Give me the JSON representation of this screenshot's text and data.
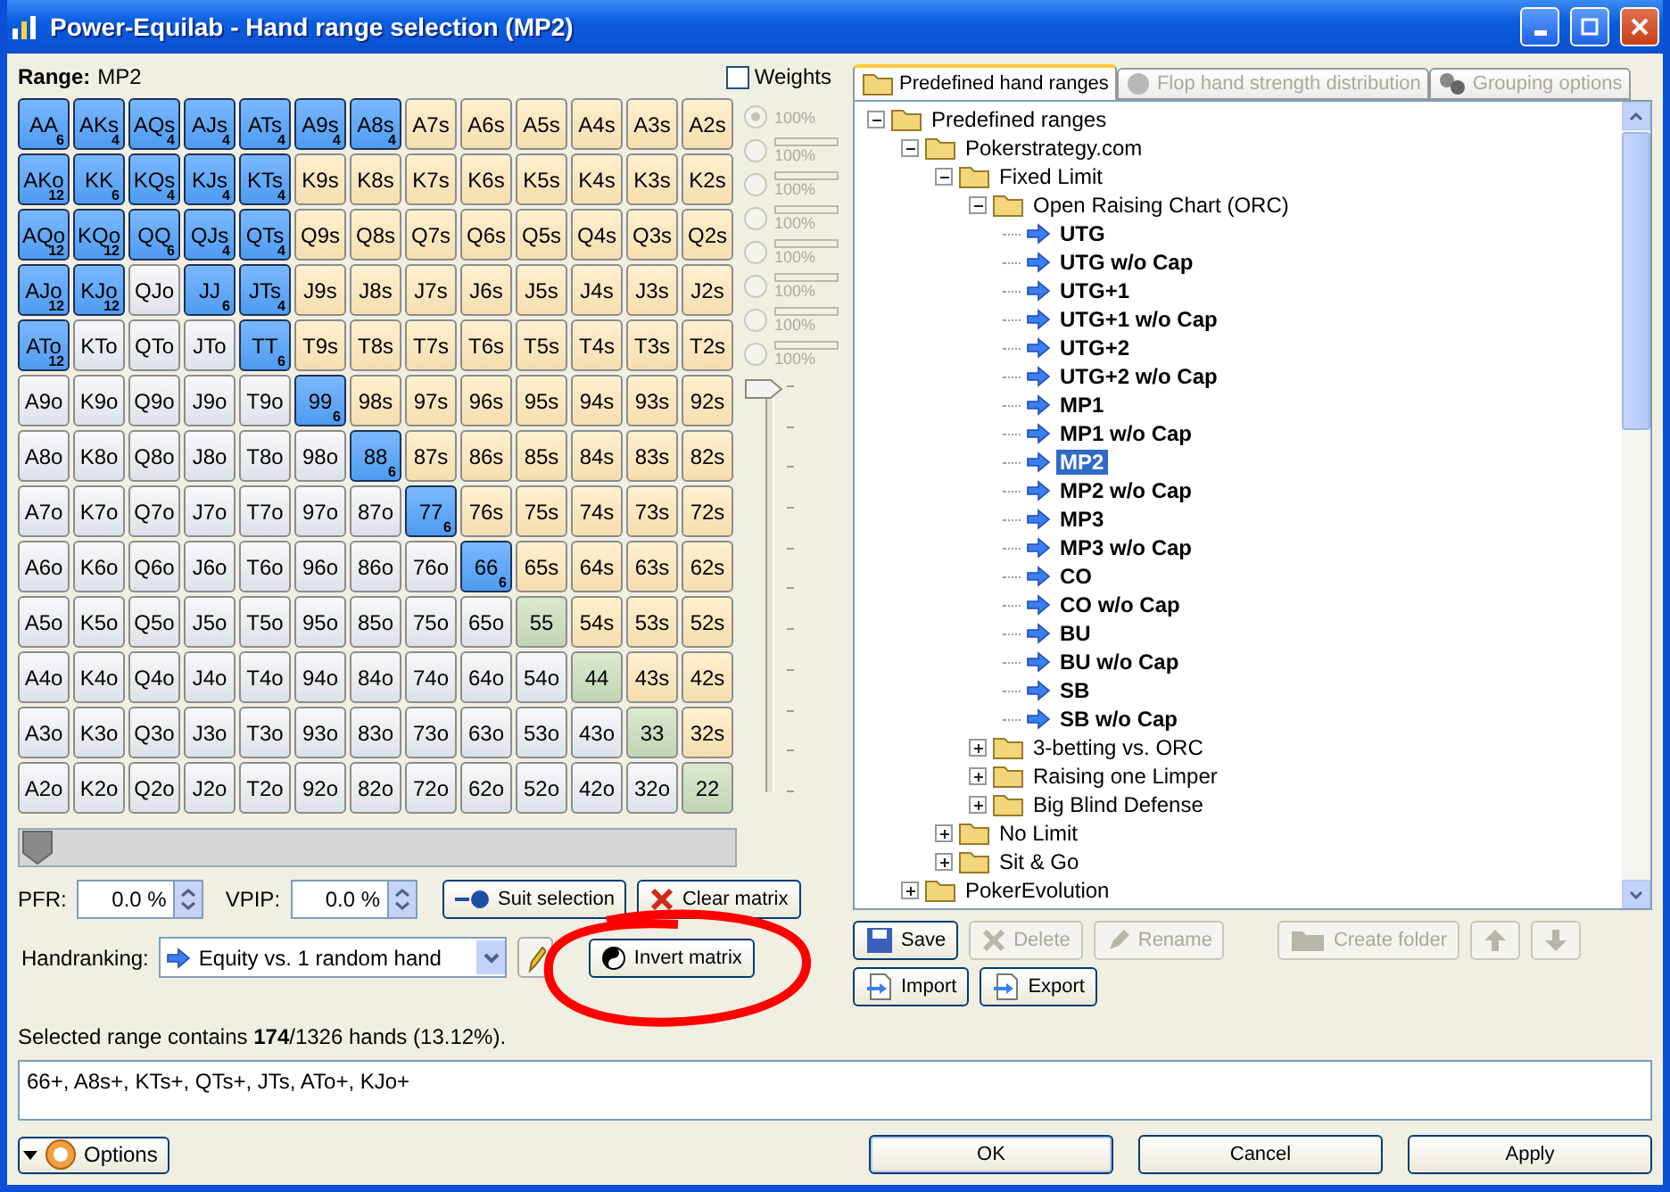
{
  "window": {
    "title": "Power-Equilab - Hand range selection (MP2)"
  },
  "range": {
    "label": "Range:",
    "value": "MP2"
  },
  "matrix": {
    "rows": [
      [
        {
          "label": "AA",
          "kind": "pair",
          "selected": true,
          "count": "6"
        },
        {
          "label": "AKs",
          "kind": "suited",
          "selected": true,
          "count": "4"
        },
        {
          "label": "AQs",
          "kind": "suited",
          "selected": true,
          "count": "4"
        },
        {
          "label": "AJs",
          "kind": "suited",
          "selected": true,
          "count": "4"
        },
        {
          "label": "ATs",
          "kind": "suited",
          "selected": true,
          "count": "4"
        },
        {
          "label": "A9s",
          "kind": "suited",
          "selected": true,
          "count": "4"
        },
        {
          "label": "A8s",
          "kind": "suited",
          "selected": true,
          "count": "4"
        },
        {
          "label": "A7s",
          "kind": "suited",
          "selected": false
        },
        {
          "label": "A6s",
          "kind": "suited",
          "selected": false
        },
        {
          "label": "A5s",
          "kind": "suited",
          "selected": false
        },
        {
          "label": "A4s",
          "kind": "suited",
          "selected": false
        },
        {
          "label": "A3s",
          "kind": "suited",
          "selected": false
        },
        {
          "label": "A2s",
          "kind": "suited",
          "selected": false
        }
      ],
      [
        {
          "label": "AKo",
          "kind": "offsuit",
          "selected": true,
          "count": "12"
        },
        {
          "label": "KK",
          "kind": "pair",
          "selected": true,
          "count": "6"
        },
        {
          "label": "KQs",
          "kind": "suited",
          "selected": true,
          "count": "4"
        },
        {
          "label": "KJs",
          "kind": "suited",
          "selected": true,
          "count": "4"
        },
        {
          "label": "KTs",
          "kind": "suited",
          "selected": true,
          "count": "4"
        },
        {
          "label": "K9s",
          "kind": "suited",
          "selected": false
        },
        {
          "label": "K8s",
          "kind": "suited",
          "selected": false
        },
        {
          "label": "K7s",
          "kind": "suited",
          "selected": false
        },
        {
          "label": "K6s",
          "kind": "suited",
          "selected": false
        },
        {
          "label": "K5s",
          "kind": "suited",
          "selected": false
        },
        {
          "label": "K4s",
          "kind": "suited",
          "selected": false
        },
        {
          "label": "K3s",
          "kind": "suited",
          "selected": false
        },
        {
          "label": "K2s",
          "kind": "suited",
          "selected": false
        }
      ],
      [
        {
          "label": "AQo",
          "kind": "offsuit",
          "selected": true,
          "count": "12"
        },
        {
          "label": "KQo",
          "kind": "offsuit",
          "selected": true,
          "count": "12"
        },
        {
          "label": "QQ",
          "kind": "pair",
          "selected": true,
          "count": "6"
        },
        {
          "label": "QJs",
          "kind": "suited",
          "selected": true,
          "count": "4"
        },
        {
          "label": "QTs",
          "kind": "suited",
          "selected": true,
          "count": "4"
        },
        {
          "label": "Q9s",
          "kind": "suited",
          "selected": false
        },
        {
          "label": "Q8s",
          "kind": "suited",
          "selected": false
        },
        {
          "label": "Q7s",
          "kind": "suited",
          "selected": false
        },
        {
          "label": "Q6s",
          "kind": "suited",
          "selected": false
        },
        {
          "label": "Q5s",
          "kind": "suited",
          "selected": false
        },
        {
          "label": "Q4s",
          "kind": "suited",
          "selected": false
        },
        {
          "label": "Q3s",
          "kind": "suited",
          "selected": false
        },
        {
          "label": "Q2s",
          "kind": "suited",
          "selected": false
        }
      ],
      [
        {
          "label": "AJo",
          "kind": "offsuit",
          "selected": true,
          "count": "12"
        },
        {
          "label": "KJo",
          "kind": "offsuit",
          "selected": true,
          "count": "12"
        },
        {
          "label": "QJo",
          "kind": "offsuit",
          "selected": false
        },
        {
          "label": "JJ",
          "kind": "pair",
          "selected": true,
          "count": "6"
        },
        {
          "label": "JTs",
          "kind": "suited",
          "selected": true,
          "count": "4"
        },
        {
          "label": "J9s",
          "kind": "suited",
          "selected": false
        },
        {
          "label": "J8s",
          "kind": "suited",
          "selected": false
        },
        {
          "label": "J7s",
          "kind": "suited",
          "selected": false
        },
        {
          "label": "J6s",
          "kind": "suited",
          "selected": false
        },
        {
          "label": "J5s",
          "kind": "suited",
          "selected": false
        },
        {
          "label": "J4s",
          "kind": "suited",
          "selected": false
        },
        {
          "label": "J3s",
          "kind": "suited",
          "selected": false
        },
        {
          "label": "J2s",
          "kind": "suited",
          "selected": false
        }
      ],
      [
        {
          "label": "ATo",
          "kind": "offsuit",
          "selected": true,
          "count": "12"
        },
        {
          "label": "KTo",
          "kind": "offsuit",
          "selected": false
        },
        {
          "label": "QTo",
          "kind": "offsuit",
          "selected": false
        },
        {
          "label": "JTo",
          "kind": "offsuit",
          "selected": false
        },
        {
          "label": "TT",
          "kind": "pair",
          "selected": true,
          "count": "6"
        },
        {
          "label": "T9s",
          "kind": "suited",
          "selected": false
        },
        {
          "label": "T8s",
          "kind": "suited",
          "selected": false
        },
        {
          "label": "T7s",
          "kind": "suited",
          "selected": false
        },
        {
          "label": "T6s",
          "kind": "suited",
          "selected": false
        },
        {
          "label": "T5s",
          "kind": "suited",
          "selected": false
        },
        {
          "label": "T4s",
          "kind": "suited",
          "selected": false
        },
        {
          "label": "T3s",
          "kind": "suited",
          "selected": false
        },
        {
          "label": "T2s",
          "kind": "suited",
          "selected": false
        }
      ],
      [
        {
          "label": "A9o",
          "kind": "offsuit",
          "selected": false
        },
        {
          "label": "K9o",
          "kind": "offsuit",
          "selected": false
        },
        {
          "label": "Q9o",
          "kind": "offsuit",
          "selected": false
        },
        {
          "label": "J9o",
          "kind": "offsuit",
          "selected": false
        },
        {
          "label": "T9o",
          "kind": "offsuit",
          "selected": false
        },
        {
          "label": "99",
          "kind": "pair",
          "selected": true,
          "count": "6"
        },
        {
          "label": "98s",
          "kind": "suited",
          "selected": false
        },
        {
          "label": "97s",
          "kind": "suited",
          "selected": false
        },
        {
          "label": "96s",
          "kind": "suited",
          "selected": false
        },
        {
          "label": "95s",
          "kind": "suited",
          "selected": false
        },
        {
          "label": "94s",
          "kind": "suited",
          "selected": false
        },
        {
          "label": "93s",
          "kind": "suited",
          "selected": false
        },
        {
          "label": "92s",
          "kind": "suited",
          "selected": false
        }
      ],
      [
        {
          "label": "A8o",
          "kind": "offsuit",
          "selected": false
        },
        {
          "label": "K8o",
          "kind": "offsuit",
          "selected": false
        },
        {
          "label": "Q8o",
          "kind": "offsuit",
          "selected": false
        },
        {
          "label": "J8o",
          "kind": "offsuit",
          "selected": false
        },
        {
          "label": "T8o",
          "kind": "offsuit",
          "selected": false
        },
        {
          "label": "98o",
          "kind": "offsuit",
          "selected": false
        },
        {
          "label": "88",
          "kind": "pair",
          "selected": true,
          "count": "6"
        },
        {
          "label": "87s",
          "kind": "suited",
          "selected": false
        },
        {
          "label": "86s",
          "kind": "suited",
          "selected": false
        },
        {
          "label": "85s",
          "kind": "suited",
          "selected": false
        },
        {
          "label": "84s",
          "kind": "suited",
          "selected": false
        },
        {
          "label": "83s",
          "kind": "suited",
          "selected": false
        },
        {
          "label": "82s",
          "kind": "suited",
          "selected": false
        }
      ],
      [
        {
          "label": "A7o",
          "kind": "offsuit",
          "selected": false
        },
        {
          "label": "K7o",
          "kind": "offsuit",
          "selected": false
        },
        {
          "label": "Q7o",
          "kind": "offsuit",
          "selected": false
        },
        {
          "label": "J7o",
          "kind": "offsuit",
          "selected": false
        },
        {
          "label": "T7o",
          "kind": "offsuit",
          "selected": false
        },
        {
          "label": "97o",
          "kind": "offsuit",
          "selected": false
        },
        {
          "label": "87o",
          "kind": "offsuit",
          "selected": false
        },
        {
          "label": "77",
          "kind": "pair",
          "selected": true,
          "count": "6"
        },
        {
          "label": "76s",
          "kind": "suited",
          "selected": false
        },
        {
          "label": "75s",
          "kind": "suited",
          "selected": false
        },
        {
          "label": "74s",
          "kind": "suited",
          "selected": false
        },
        {
          "label": "73s",
          "kind": "suited",
          "selected": false
        },
        {
          "label": "72s",
          "kind": "suited",
          "selected": false
        }
      ],
      [
        {
          "label": "A6o",
          "kind": "offsuit",
          "selected": false
        },
        {
          "label": "K6o",
          "kind": "offsuit",
          "selected": false
        },
        {
          "label": "Q6o",
          "kind": "offsuit",
          "selected": false
        },
        {
          "label": "J6o",
          "kind": "offsuit",
          "selected": false
        },
        {
          "label": "T6o",
          "kind": "offsuit",
          "selected": false
        },
        {
          "label": "96o",
          "kind": "offsuit",
          "selected": false
        },
        {
          "label": "86o",
          "kind": "offsuit",
          "selected": false
        },
        {
          "label": "76o",
          "kind": "offsuit",
          "selected": false
        },
        {
          "label": "66",
          "kind": "pair",
          "selected": true,
          "count": "6"
        },
        {
          "label": "65s",
          "kind": "suited",
          "selected": false
        },
        {
          "label": "64s",
          "kind": "suited",
          "selected": false
        },
        {
          "label": "63s",
          "kind": "suited",
          "selected": false
        },
        {
          "label": "62s",
          "kind": "suited",
          "selected": false
        }
      ],
      [
        {
          "label": "A5o",
          "kind": "offsuit",
          "selected": false
        },
        {
          "label": "K5o",
          "kind": "offsuit",
          "selected": false
        },
        {
          "label": "Q5o",
          "kind": "offsuit",
          "selected": false
        },
        {
          "label": "J5o",
          "kind": "offsuit",
          "selected": false
        },
        {
          "label": "T5o",
          "kind": "offsuit",
          "selected": false
        },
        {
          "label": "95o",
          "kind": "offsuit",
          "selected": false
        },
        {
          "label": "85o",
          "kind": "offsuit",
          "selected": false
        },
        {
          "label": "75o",
          "kind": "offsuit",
          "selected": false
        },
        {
          "label": "65o",
          "kind": "offsuit",
          "selected": false
        },
        {
          "label": "55",
          "kind": "pair",
          "selected": false
        },
        {
          "label": "54s",
          "kind": "suited",
          "selected": false
        },
        {
          "label": "53s",
          "kind": "suited",
          "selected": false
        },
        {
          "label": "52s",
          "kind": "suited",
          "selected": false
        }
      ],
      [
        {
          "label": "A4o",
          "kind": "offsuit",
          "selected": false
        },
        {
          "label": "K4o",
          "kind": "offsuit",
          "selected": false
        },
        {
          "label": "Q4o",
          "kind": "offsuit",
          "selected": false
        },
        {
          "label": "J4o",
          "kind": "offsuit",
          "selected": false
        },
        {
          "label": "T4o",
          "kind": "offsuit",
          "selected": false
        },
        {
          "label": "94o",
          "kind": "offsuit",
          "selected": false
        },
        {
          "label": "84o",
          "kind": "offsuit",
          "selected": false
        },
        {
          "label": "74o",
          "kind": "offsuit",
          "selected": false
        },
        {
          "label": "64o",
          "kind": "offsuit",
          "selected": false
        },
        {
          "label": "54o",
          "kind": "offsuit",
          "selected": false
        },
        {
          "label": "44",
          "kind": "pair",
          "selected": false
        },
        {
          "label": "43s",
          "kind": "suited",
          "selected": false
        },
        {
          "label": "42s",
          "kind": "suited",
          "selected": false
        }
      ],
      [
        {
          "label": "A3o",
          "kind": "offsuit",
          "selected": false
        },
        {
          "label": "K3o",
          "kind": "offsuit",
          "selected": false
        },
        {
          "label": "Q3o",
          "kind": "offsuit",
          "selected": false
        },
        {
          "label": "J3o",
          "kind": "offsuit",
          "selected": false
        },
        {
          "label": "T3o",
          "kind": "offsuit",
          "selected": false
        },
        {
          "label": "93o",
          "kind": "offsuit",
          "selected": false
        },
        {
          "label": "83o",
          "kind": "offsuit",
          "selected": false
        },
        {
          "label": "73o",
          "kind": "offsuit",
          "selected": false
        },
        {
          "label": "63o",
          "kind": "offsuit",
          "selected": false
        },
        {
          "label": "53o",
          "kind": "offsuit",
          "selected": false
        },
        {
          "label": "43o",
          "kind": "offsuit",
          "selected": false
        },
        {
          "label": "33",
          "kind": "pair",
          "selected": false
        },
        {
          "label": "32s",
          "kind": "suited",
          "selected": false
        }
      ],
      [
        {
          "label": "A2o",
          "kind": "offsuit",
          "selected": false
        },
        {
          "label": "K2o",
          "kind": "offsuit",
          "selected": false
        },
        {
          "label": "Q2o",
          "kind": "offsuit",
          "selected": false
        },
        {
          "label": "J2o",
          "kind": "offsuit",
          "selected": false
        },
        {
          "label": "T2o",
          "kind": "offsuit",
          "selected": false
        },
        {
          "label": "92o",
          "kind": "offsuit",
          "selected": false
        },
        {
          "label": "82o",
          "kind": "offsuit",
          "selected": false
        },
        {
          "label": "72o",
          "kind": "offsuit",
          "selected": false
        },
        {
          "label": "62o",
          "kind": "offsuit",
          "selected": false
        },
        {
          "label": "52o",
          "kind": "offsuit",
          "selected": false
        },
        {
          "label": "42o",
          "kind": "offsuit",
          "selected": false
        },
        {
          "label": "32o",
          "kind": "offsuit",
          "selected": false
        },
        {
          "label": "22",
          "kind": "pair",
          "selected": false
        }
      ]
    ]
  },
  "weights": {
    "label": "Weights",
    "checked": false,
    "options": [
      {
        "label": "100%",
        "kind": "plain",
        "selected": true
      },
      {
        "label": "100%",
        "kind": "bar",
        "selected": false
      },
      {
        "label": "100%",
        "kind": "bar",
        "selected": false
      },
      {
        "label": "100%",
        "kind": "bar",
        "selected": false
      },
      {
        "label": "100%",
        "kind": "bar",
        "selected": false
      },
      {
        "label": "100%",
        "kind": "bar",
        "selected": false
      },
      {
        "label": "100%",
        "kind": "bar",
        "selected": false
      },
      {
        "label": "100%",
        "kind": "bar",
        "selected": false
      }
    ],
    "slider": {
      "level": 1
    }
  },
  "range_slider": {
    "level": 0
  },
  "pfr": {
    "label": "PFR:",
    "value": "0.0 %"
  },
  "vpip": {
    "label": "VPIP:",
    "value": "0.0 %"
  },
  "suit_selection": "Suit selection",
  "clear_matrix": "Clear matrix",
  "handranking": {
    "label": "Handranking:",
    "value": "Equity vs. 1 random hand"
  },
  "invert_matrix": "Invert matrix",
  "summary": "Selected range contains **174**/1326 hands (13.12%).",
  "range_text": "66+, A8s+, KTs+, QTs+, JTs, ATo+, KJo+",
  "tabs": [
    {
      "label": "Predefined hand ranges",
      "selected": true,
      "disabled": false,
      "kind": "folder"
    },
    {
      "label": "Flop hand strength distribution",
      "selected": false,
      "disabled": true,
      "kind": "chart"
    },
    {
      "label": "Grouping options",
      "selected": false,
      "disabled": true,
      "kind": "group"
    }
  ],
  "tree": [
    {
      "label": "Predefined ranges",
      "kind": "folder",
      "expanded": true,
      "children": [
        {
          "label": "Pokerstrategy.com",
          "kind": "folder",
          "expanded": true,
          "children": [
            {
              "label": "Fixed Limit",
              "kind": "folder",
              "expanded": true,
              "children": [
                {
                  "label": "Open Raising Chart (ORC)",
                  "kind": "folder",
                  "expanded": true,
                  "children": [
                    {
                      "label": "UTG",
                      "kind": "range",
                      "selected": false
                    },
                    {
                      "label": "UTG w/o Cap",
                      "kind": "range",
                      "selected": false
                    },
                    {
                      "label": "UTG+1",
                      "kind": "range",
                      "selected": false
                    },
                    {
                      "label": "UTG+1 w/o Cap",
                      "kind": "range",
                      "selected": false
                    },
                    {
                      "label": "UTG+2",
                      "kind": "range",
                      "selected": false
                    },
                    {
                      "label": "UTG+2 w/o Cap",
                      "kind": "range",
                      "selected": false
                    },
                    {
                      "label": "MP1",
                      "kind": "range",
                      "selected": false
                    },
                    {
                      "label": "MP1 w/o Cap",
                      "kind": "range",
                      "selected": false
                    },
                    {
                      "label": "MP2",
                      "kind": "range",
                      "selected": true
                    },
                    {
                      "label": "MP2 w/o Cap",
                      "kind": "range",
                      "selected": false
                    },
                    {
                      "label": "MP3",
                      "kind": "range",
                      "selected": false
                    },
                    {
                      "label": "MP3 w/o Cap",
                      "kind": "range",
                      "selected": false
                    },
                    {
                      "label": "CO",
                      "kind": "range",
                      "selected": false
                    },
                    {
                      "label": "CO w/o Cap",
                      "kind": "range",
                      "selected": false
                    },
                    {
                      "label": "BU",
                      "kind": "range",
                      "selected": false
                    },
                    {
                      "label": "BU w/o Cap",
                      "kind": "range",
                      "selected": false
                    },
                    {
                      "label": "SB",
                      "kind": "range",
                      "selected": false
                    },
                    {
                      "label": "SB w/o Cap",
                      "kind": "range",
                      "selected": false
                    }
                  ]
                },
                {
                  "label": "3-betting vs. ORC",
                  "kind": "folder",
                  "expanded": false
                },
                {
                  "label": "Raising one Limper",
                  "kind": "folder",
                  "expanded": false
                },
                {
                  "label": "Big Blind Defense",
                  "kind": "folder",
                  "expanded": false
                }
              ]
            },
            {
              "label": "No Limit",
              "kind": "folder",
              "expanded": false
            },
            {
              "label": "Sit & Go",
              "kind": "folder",
              "expanded": false
            }
          ]
        },
        {
          "label": "PokerEvolution",
          "kind": "folder",
          "expanded": false
        }
      ]
    }
  ],
  "tree_buttons": [
    [
      {
        "label": "Save",
        "kind": "save",
        "disabled": false
      },
      {
        "label": "Delete",
        "kind": "delete",
        "disabled": true
      },
      {
        "label": "Rename",
        "kind": "rename",
        "disabled": true
      },
      {
        "kind": "spacer"
      },
      {
        "label": "Create folder",
        "kind": "folder",
        "disabled": true
      },
      {
        "kind": "up",
        "disabled": true
      },
      {
        "kind": "down",
        "disabled": true
      }
    ],
    [
      {
        "label": "Import",
        "kind": "import",
        "disabled": false
      },
      {
        "label": "Export",
        "kind": "export",
        "disabled": false
      }
    ]
  ],
  "options": "Options",
  "dialog_buttons": [
    {
      "label": "OK",
      "default": true
    },
    {
      "label": "Cancel",
      "default": false
    },
    {
      "label": "Apply",
      "default": false
    }
  ]
}
